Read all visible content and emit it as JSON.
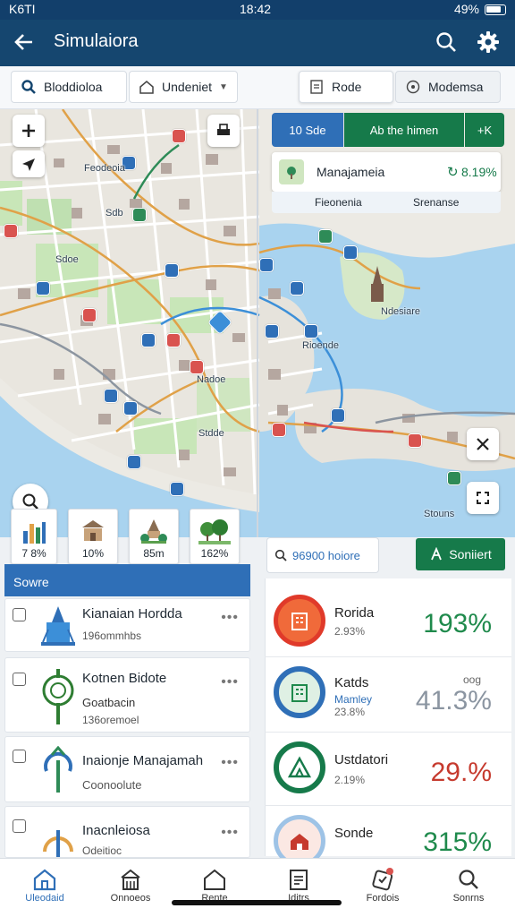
{
  "status": {
    "carrier": "K6TI",
    "time": "18:42",
    "battery": "49%"
  },
  "appbar": {
    "title": "Simulaiora"
  },
  "filters": {
    "left": "Bloddioloa",
    "middle": "Undeniet",
    "tab_active": "Rode",
    "tab_other": "Modemsa"
  },
  "map": {
    "toggle_left": "10 Sde",
    "toggle_mid": "Ab the himen",
    "toggle_right": "+K",
    "card_title": "Manajameia",
    "card_value": "8.19%",
    "card_sub_left": "Fieonenia",
    "card_sub_right": "Srenanse",
    "labels": [
      "Feodeoia",
      "Sdoe",
      "Sdb",
      "Nadoe",
      "Rioende",
      "Stdde",
      "Stouns",
      "Ndesiare"
    ]
  },
  "tiles": [
    {
      "icon": "bar-chart-icon",
      "value": "7 8%"
    },
    {
      "icon": "temple-icon",
      "value": "10%"
    },
    {
      "icon": "park-icon",
      "value": "85m"
    },
    {
      "icon": "trees-icon",
      "value": "162%"
    }
  ],
  "section_title": "Sowre",
  "left_list": [
    {
      "title": "Kianaian Hordda",
      "subtitle": "196ommhbs",
      "extra": ""
    },
    {
      "title": "Kotnen Bidote",
      "subtitle": "Goatbacin",
      "extra": "136oremoel"
    },
    {
      "title": "Inaionje Manajamah",
      "subtitle": "Coonoolute",
      "extra": ""
    },
    {
      "title": "Inacnleiosa",
      "subtitle": "Odeitioc",
      "extra": ""
    }
  ],
  "right": {
    "search": "96900 hoiore",
    "button": "Soniiert",
    "rows": [
      {
        "name": "Rorida",
        "sub": "2.93%",
        "extra": "",
        "pct": "193%",
        "color": "#1f8a4c"
      },
      {
        "name": "Katds",
        "sub": "Mamley",
        "extra": "23.8%",
        "pct": "41.3%",
        "color": "#8b95a1"
      },
      {
        "name": "Ustdatori",
        "sub": "2.19%",
        "extra": "",
        "pct": "29.%",
        "color": "#c63a2e"
      },
      {
        "name": "Sonde",
        "sub": "",
        "extra": "",
        "pct": "315%",
        "color": "#1f8a4c"
      }
    ],
    "row2_tag": "oog"
  },
  "nav": [
    {
      "icon": "home-icon",
      "label": "Uleodaid"
    },
    {
      "icon": "building-icon",
      "label": "Onnoeos"
    },
    {
      "icon": "house-icon",
      "label": "Rente"
    },
    {
      "icon": "document-icon",
      "label": "Iditrs"
    },
    {
      "icon": "badge-icon",
      "label": "Fordois"
    },
    {
      "icon": "search-icon",
      "label": "Sonrns"
    }
  ],
  "colors": {
    "primary": "#15466f",
    "accent_blue": "#2f6fb7",
    "accent_green": "#167a4a",
    "alert_red": "#c63a2e"
  }
}
